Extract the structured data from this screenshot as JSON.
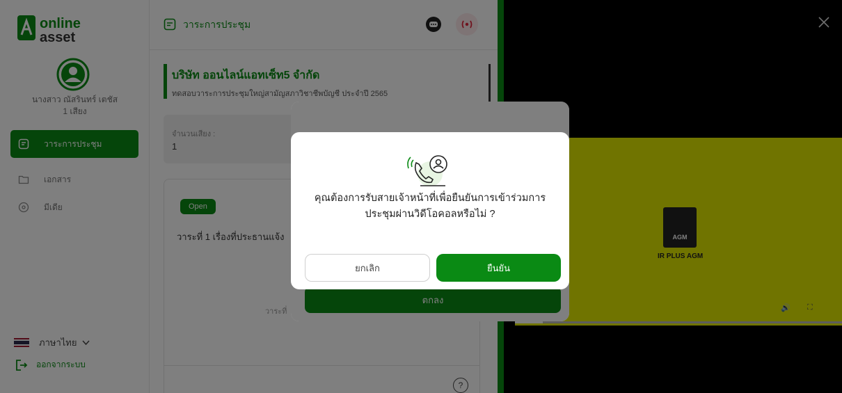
{
  "sidebar": {
    "logo_text_top": "online",
    "logo_text_bottom": "asset",
    "user_name": "นางสาว ณัสรินทร์ เตชัส",
    "user_votes": "1 เสียง",
    "items": [
      {
        "label": "วาระการประชุม",
        "icon": "agenda-icon",
        "active": true
      },
      {
        "label": "เอกสาร",
        "icon": "folder-icon",
        "active": false
      },
      {
        "label": "มีเดีย",
        "icon": "media-icon",
        "active": false
      }
    ],
    "language": "ภาษาไทย",
    "logout": "ออกจากระบบ"
  },
  "main": {
    "title": "วาระการประชุม",
    "company_name": "บริษัท ออนไลน์แอทเซ็ท5 จำกัด",
    "company_sub": "ทดสอบวาระการประชุมใหญ่สามัญสภาวิชาชีพบัญชี ประจำปี 2565",
    "votes_label": "จำนวนเสียง :",
    "votes_value": "1",
    "open_badge": "Open",
    "agenda_text": "วาระที่ 1 เรื่องที่ประธานแจ้ง",
    "agenda_faint": "วาระที่",
    "help": "?"
  },
  "video": {
    "caption": "IR PLUS AGM",
    "logo_text": "AGM",
    "played_fraction": 0.085
  },
  "back_modal": {
    "confirm_label": "ตกลง"
  },
  "modal": {
    "message_line1": "คุณต้องการรับสายเจ้าหน้าที่เพื่อยืนยันการเข้าร่วมการ",
    "message_line2": "ประชุมผ่านวิดีโอคอลหรือไม่ ?",
    "cancel_label": "ยกเลิก",
    "confirm_label": "ยืนยัน"
  },
  "colors": {
    "brand_green": "#0a8a14",
    "live_red": "#e0243a",
    "video_yellow": "#e0e800"
  }
}
